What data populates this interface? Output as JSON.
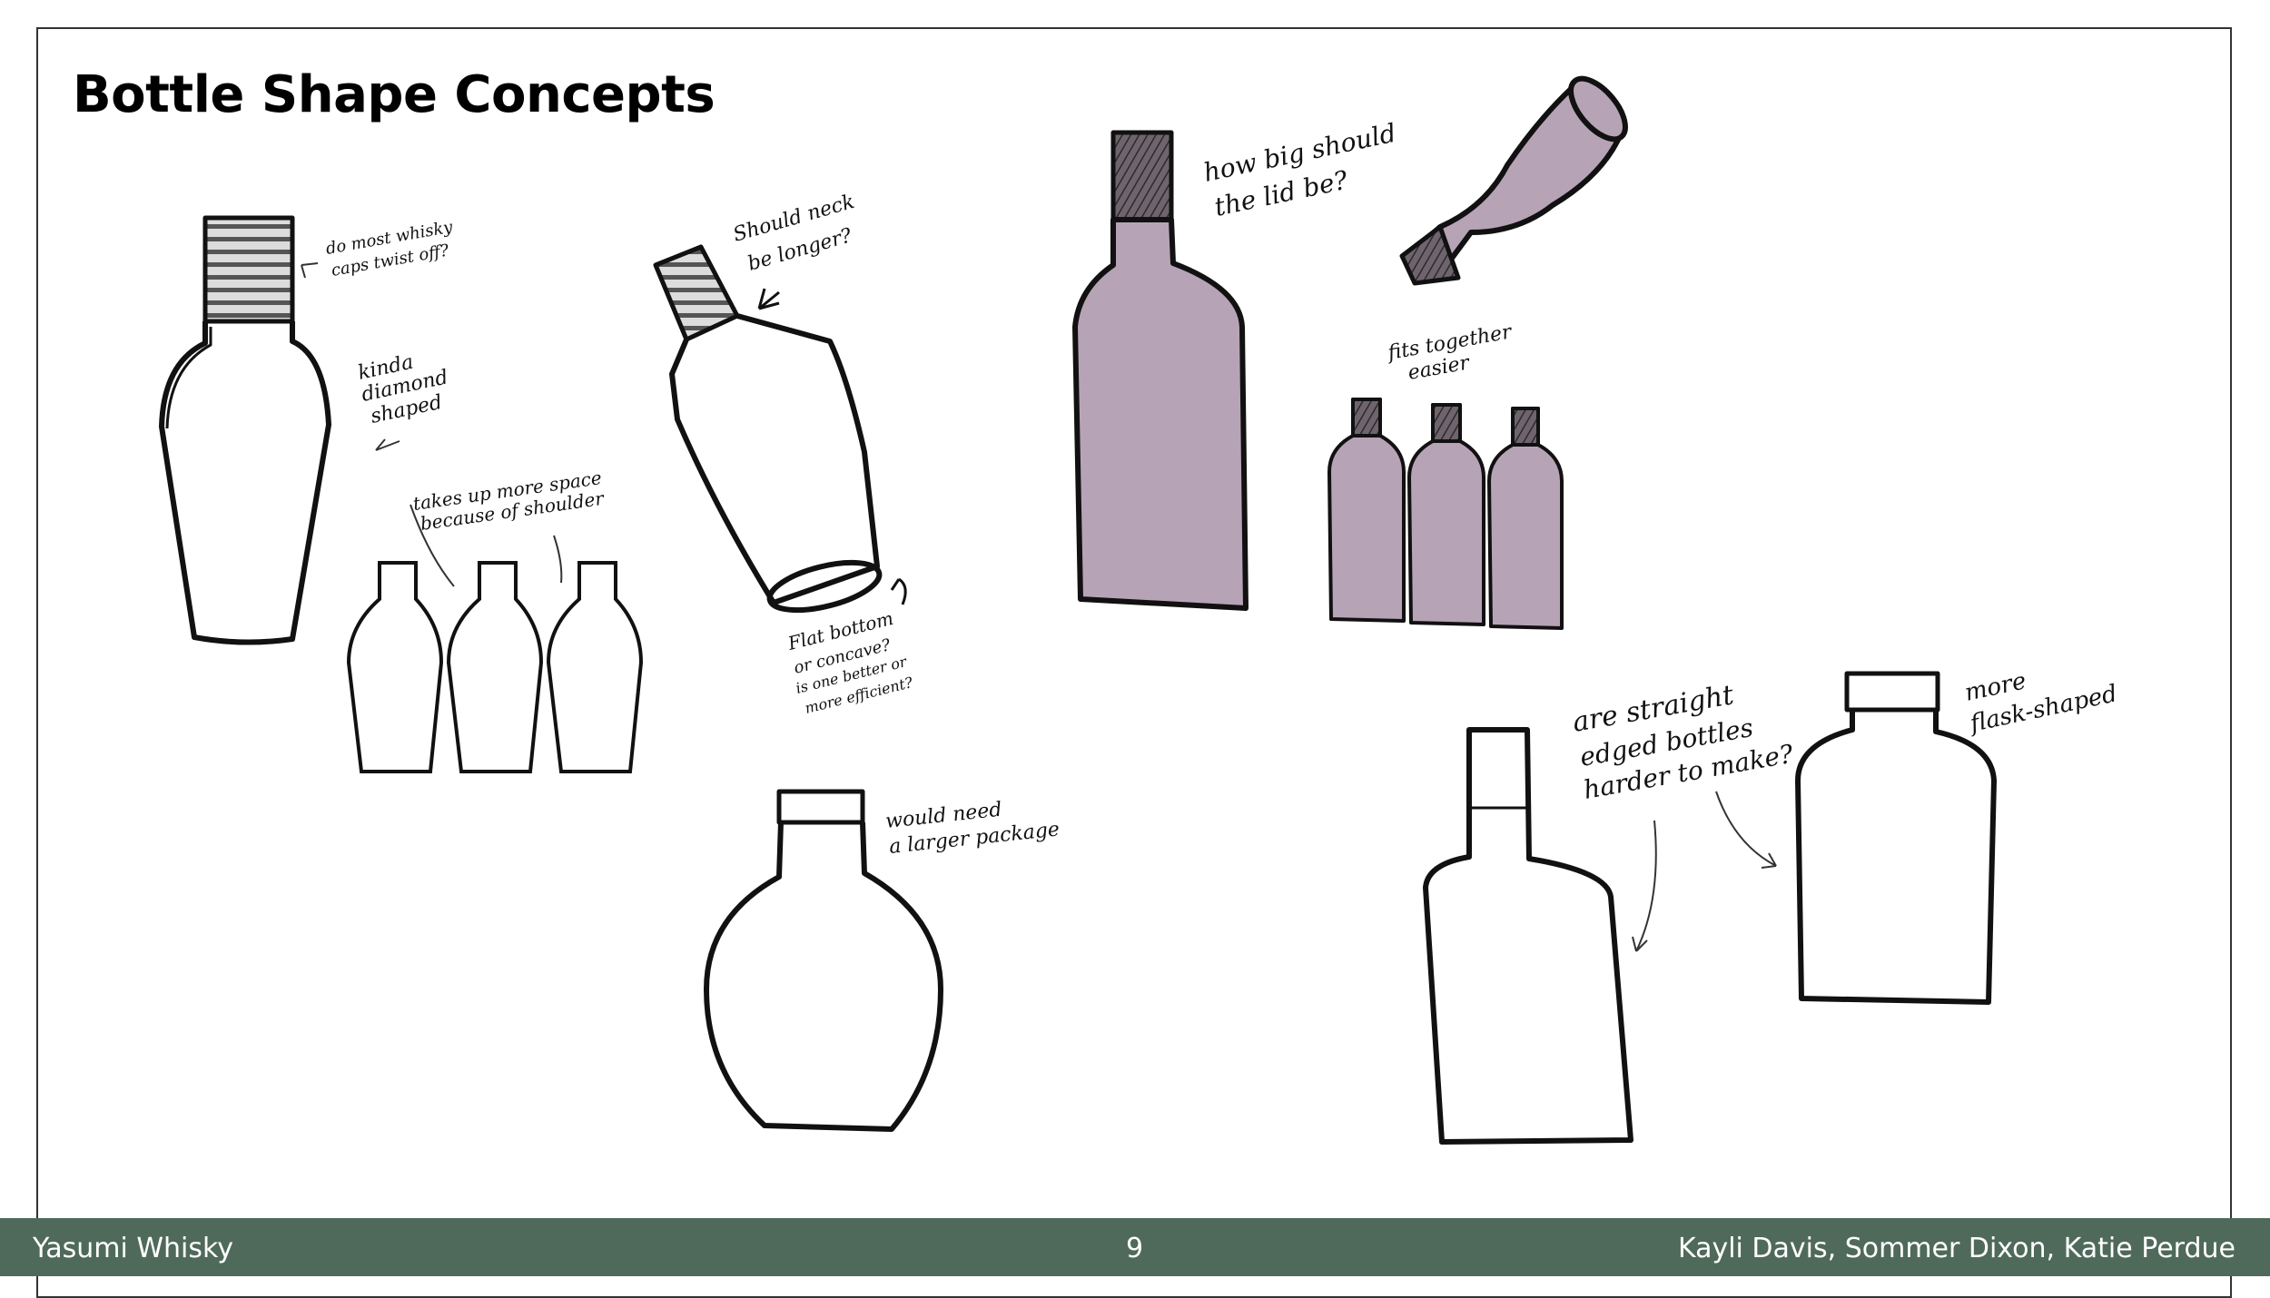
{
  "slide": {
    "title": "Bottle Shape Concepts",
    "footer_left": "Yasumi Whisky",
    "page_number": "9",
    "footer_right": "Kayli Davis, Sommer Dixon, Katie Perdue"
  },
  "notes": {
    "twist_off_1": "do most whisky",
    "twist_off_2": "caps twist off?",
    "diamond_1": "kinda",
    "diamond_2": "diamond",
    "diamond_3": "shaped",
    "shoulder_1": "takes up more space",
    "shoulder_2": "because of shoulder",
    "neck_1": "Should neck",
    "neck_2": "be longer?",
    "bottom_1": "Flat bottom",
    "bottom_2": "or concave?",
    "bottom_3": "is one better or",
    "bottom_4": "more efficient?",
    "package_1": "would need",
    "package_2": "a larger package",
    "lid_1": "how big should",
    "lid_2": "the lid be?",
    "fits_1": "fits together",
    "fits_2": "easier",
    "straight_1": "are straight",
    "straight_2": "edged bottles",
    "straight_3": "harder to make?",
    "flask_1": "more",
    "flask_2": "flask-shaped"
  },
  "colors": {
    "footer_bg": "#4f6a5b",
    "bottle_fill": "#b7a3b6",
    "ink": "#111111"
  }
}
